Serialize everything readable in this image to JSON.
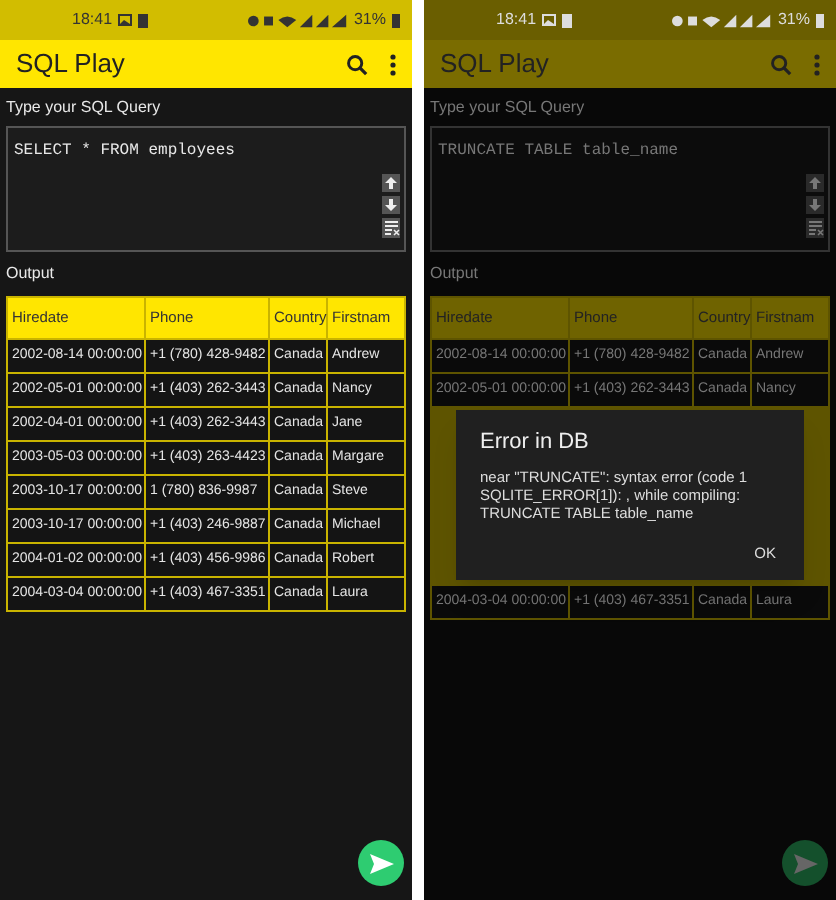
{
  "screens": [
    {
      "dimmed": false,
      "status_bar": {
        "time": "18:41",
        "battery": "31%"
      },
      "app_bar": {
        "title": "SQL Play"
      },
      "query_label": "Type your SQL Query",
      "query": "SELECT * FROM employees",
      "output_label": "Output",
      "table": {
        "columns": [
          "Hiredate",
          "Phone",
          "Country",
          "Firstnam"
        ],
        "rows": [
          [
            "2002-08-14 00:00:00",
            "+1 (780) 428-9482",
            "Canada",
            "Andrew"
          ],
          [
            "2002-05-01 00:00:00",
            "+1 (403) 262-3443",
            "Canada",
            "Nancy"
          ],
          [
            "2002-04-01 00:00:00",
            "+1 (403) 262-3443",
            "Canada",
            "Jane"
          ],
          [
            "2003-05-03 00:00:00",
            "+1 (403) 263-4423",
            "Canada",
            "Margare"
          ],
          [
            "2003-10-17 00:00:00",
            "1 (780) 836-9987",
            "Canada",
            "Steve"
          ],
          [
            "2003-10-17 00:00:00",
            "+1 (403) 246-9887",
            "Canada",
            "Michael"
          ],
          [
            "2004-01-02 00:00:00",
            "+1 (403) 456-9986",
            "Canada",
            "Robert"
          ],
          [
            "2004-03-04 00:00:00",
            "+1 (403) 467-3351",
            "Canada",
            "Laura"
          ]
        ]
      }
    },
    {
      "dimmed": true,
      "status_bar": {
        "time": "18:41",
        "battery": "31%"
      },
      "app_bar": {
        "title": "SQL Play"
      },
      "query_label": "Type your SQL Query",
      "query": "TRUNCATE TABLE table_name",
      "output_label": "Output",
      "table": {
        "columns": [
          "Hiredate",
          "Phone",
          "Country",
          "Firstnam"
        ],
        "rows": [
          [
            "2002-08-14 00:00:00",
            "+1 (780) 428-9482",
            "Canada",
            "Andrew"
          ],
          [
            "2002-05-01 00:00:00",
            "+1 (403) 262-3443",
            "Canada",
            "Nancy"
          ]
        ],
        "rows_after_dialog": [
          [
            "2004-03-04 00:00:00",
            "+1 (403) 467-3351",
            "Canada",
            "Laura"
          ]
        ]
      },
      "dialog": {
        "title": "Error in DB",
        "message": "near \"TRUNCATE\": syntax error (code 1 SQLITE_ERROR[1]): , while compiling: TRUNCATE TABLE table_name",
        "button": "OK"
      }
    }
  ]
}
